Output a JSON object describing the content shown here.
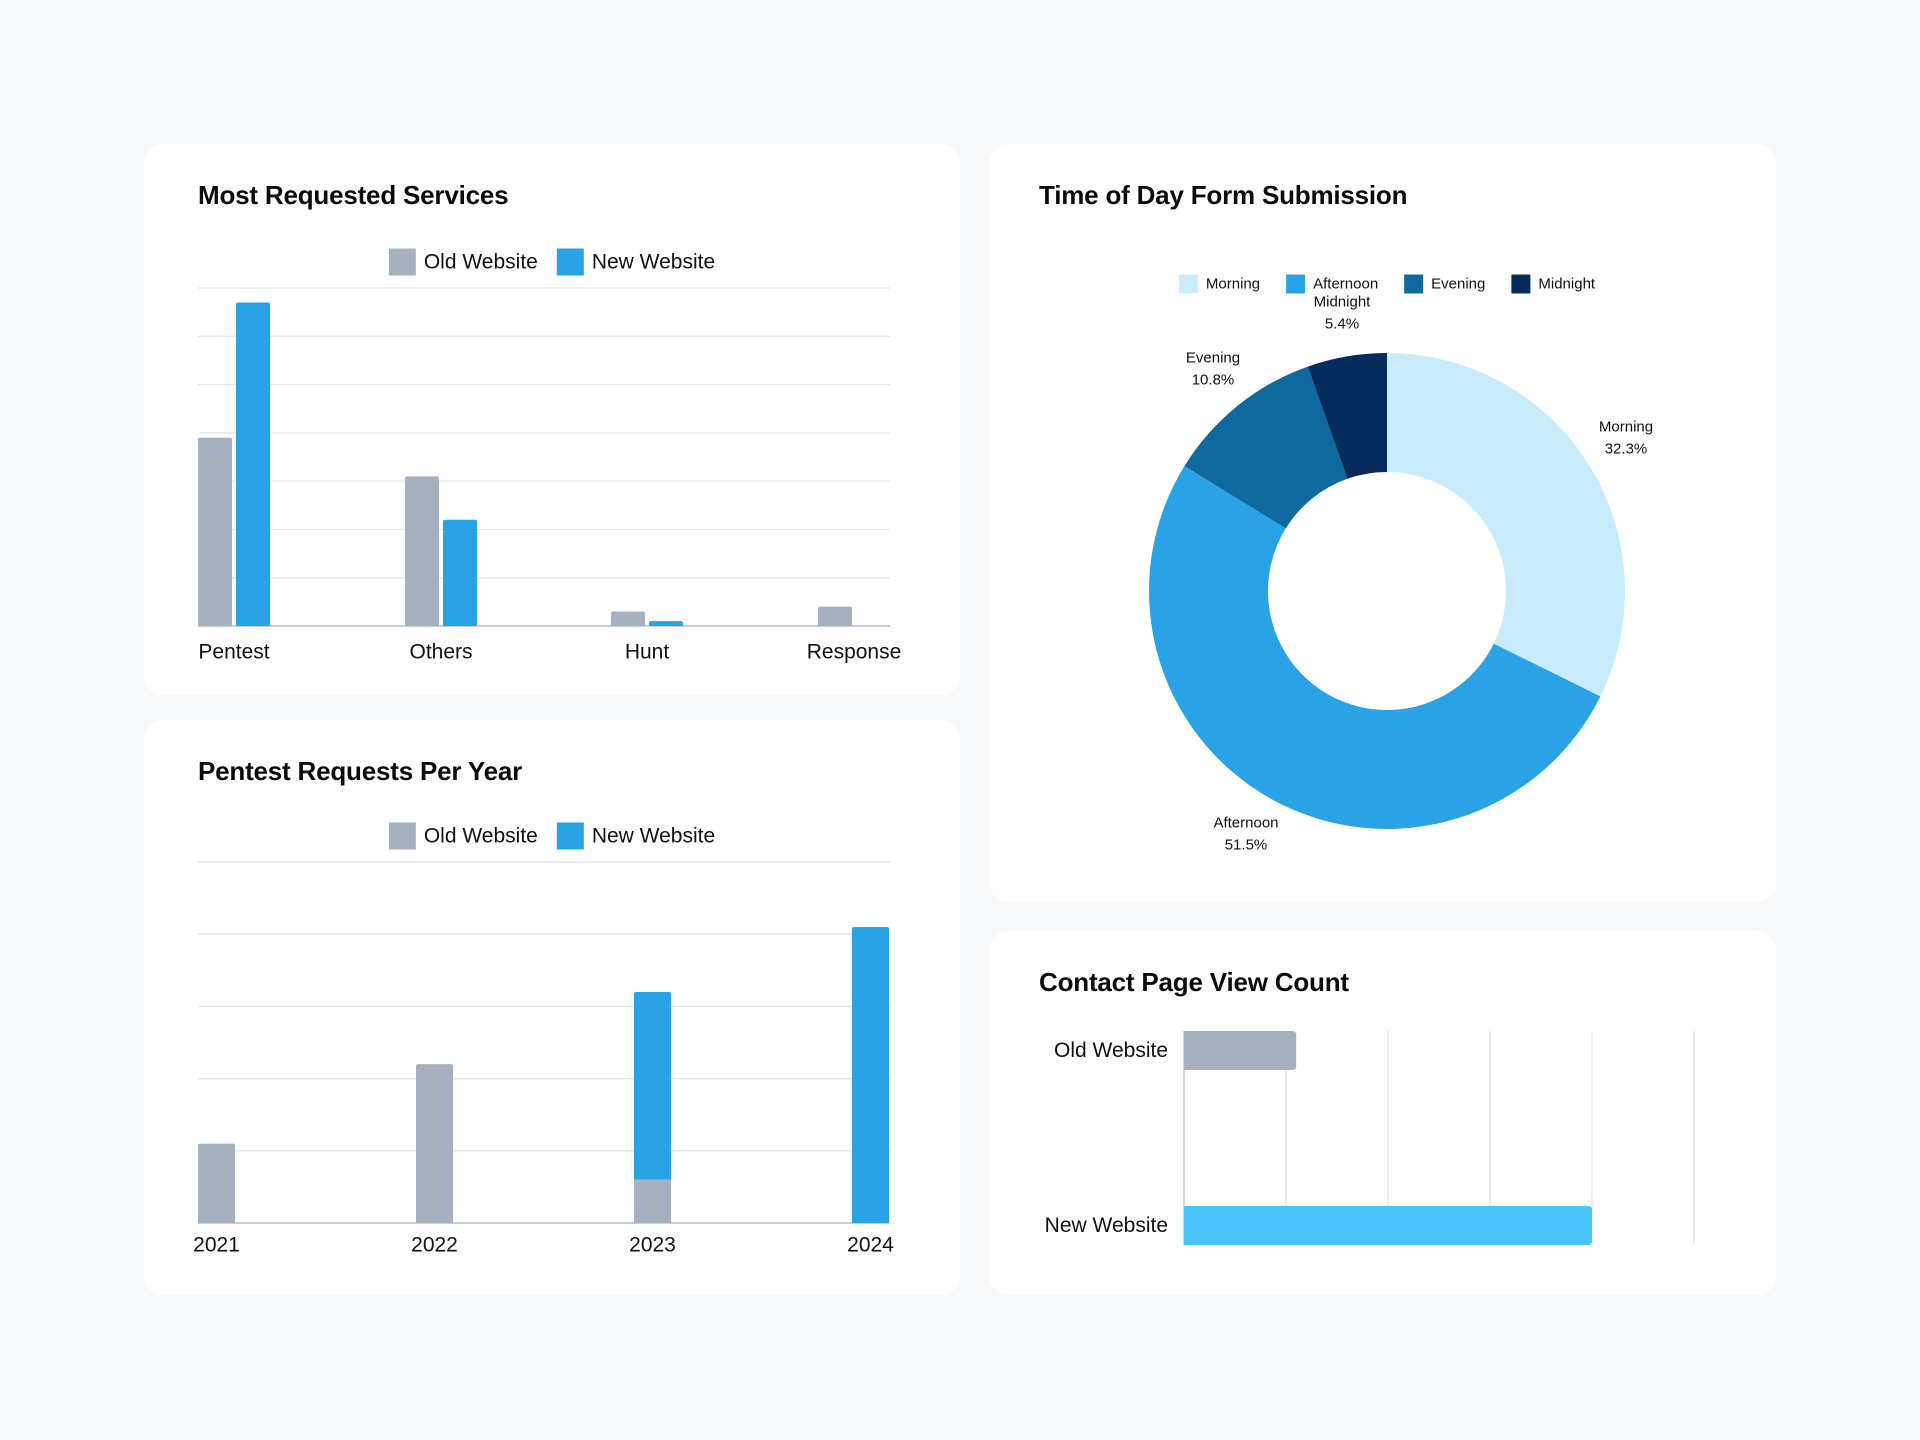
{
  "page": {
    "background": "#f8f9fb"
  },
  "colors": {
    "old_website": "#a7b0bf",
    "new_website": "#29a3e5",
    "new_website_contact": "#49c3fc",
    "morning": "#c9ecfc",
    "afternoon": "#29a3e5",
    "evening": "#0e6a9c",
    "midnight": "#042b5b",
    "gridline": "#e3e5e8",
    "axis": "#c9ced6"
  },
  "chart_data": [
    {
      "id": "most-requested-services",
      "type": "bar",
      "title": "Most Requested Services",
      "legend": [
        "Old Website",
        "New Website"
      ],
      "legend_position": "top-center",
      "categories": [
        "Pentest",
        "Others",
        "Hunt",
        "Response"
      ],
      "series": [
        {
          "name": "Old Website",
          "values": [
            3.9,
            3.1,
            0.3,
            0.4
          ]
        },
        {
          "name": "New Website",
          "values": [
            6.7,
            2.2,
            0.1,
            0
          ]
        }
      ],
      "xlabel": "",
      "ylabel": "",
      "ylim": [
        0,
        7
      ],
      "y_gridlines": 7,
      "grid": true,
      "y_tick_labels_visible": false
    },
    {
      "id": "pentest-requests-per-year",
      "type": "bar",
      "stacked": true,
      "title": "Pentest Requests Per Year",
      "legend": [
        "Old Website",
        "New Website"
      ],
      "legend_position": "top-center",
      "categories": [
        "2021",
        "2022",
        "2023",
        "2024"
      ],
      "series": [
        {
          "name": "Old Website",
          "values": [
            1.1,
            2.2,
            0.6,
            0
          ]
        },
        {
          "name": "New Website",
          "values": [
            0,
            0,
            2.6,
            4.1
          ]
        }
      ],
      "xlabel": "",
      "ylabel": "",
      "ylim": [
        0,
        5
      ],
      "y_gridlines": 5,
      "grid": true,
      "y_tick_labels_visible": false
    },
    {
      "id": "time-of-day-form-submission",
      "type": "pie",
      "donut": true,
      "title": "Time of Day Form Submission",
      "legend_position": "top-center",
      "labels": [
        "Morning",
        "Afternoon",
        "Evening",
        "Midnight"
      ],
      "values": [
        32.3,
        51.5,
        10.8,
        5.4
      ],
      "value_labels": [
        "32.3%",
        "51.5%",
        "10.8%",
        "5.4%"
      ]
    },
    {
      "id": "contact-page-view-count",
      "type": "bar",
      "orientation": "horizontal",
      "title": "Contact Page View Count",
      "categories": [
        "Old Website",
        "New Website"
      ],
      "values": [
        1.1,
        4.0
      ],
      "xlim": [
        0,
        5
      ],
      "x_gridlines": 5,
      "grid": true,
      "x_tick_labels_visible": false
    }
  ]
}
